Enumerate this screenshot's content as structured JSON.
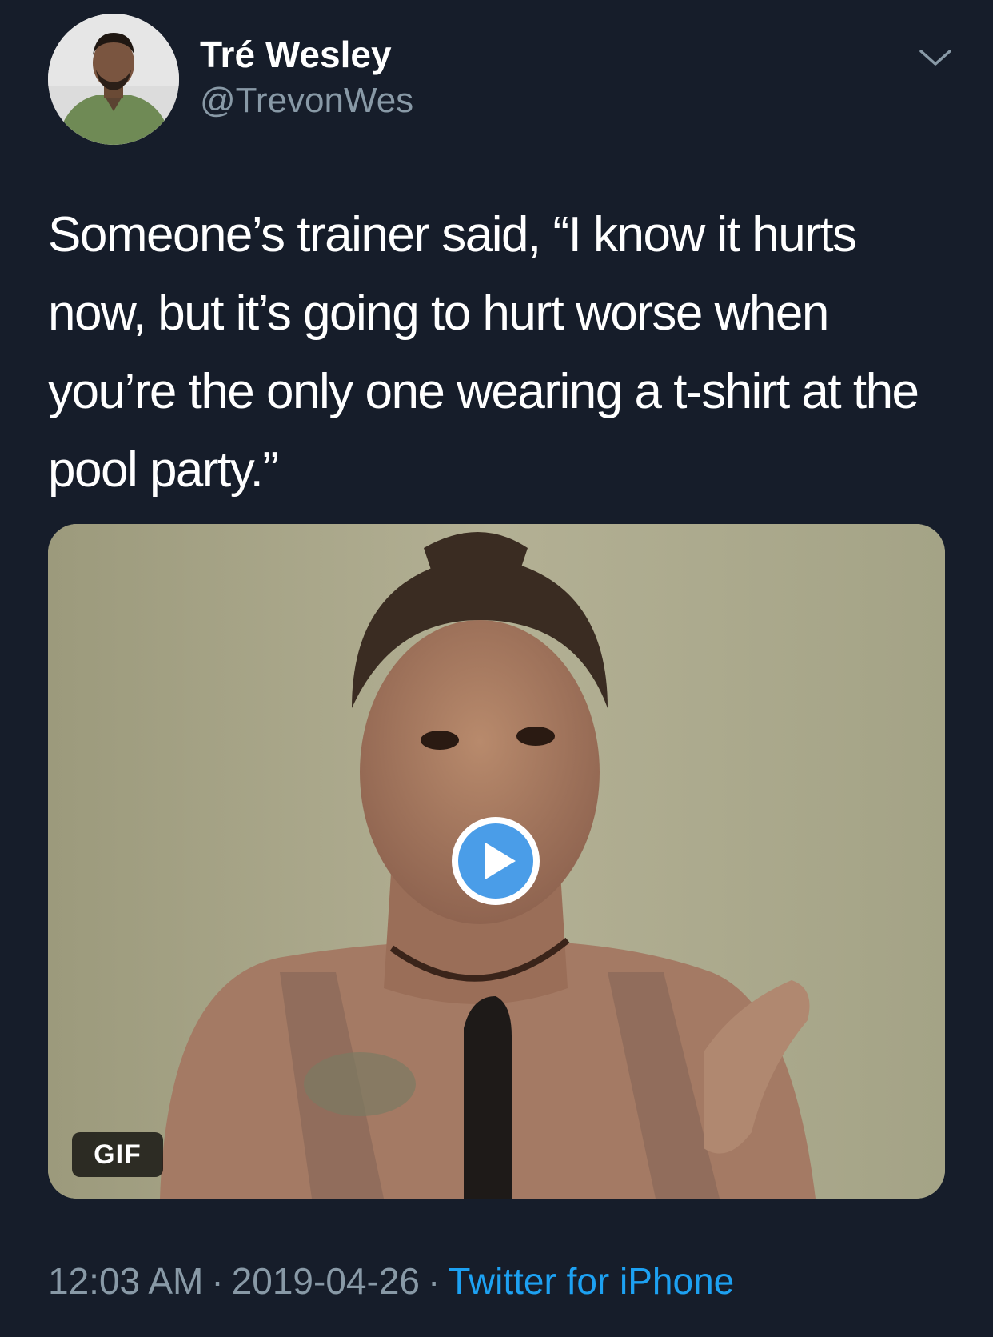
{
  "author": {
    "display_name": "Tré Wesley",
    "handle": "@TrevonWes",
    "avatar_icon": "user-avatar"
  },
  "header": {
    "menu_icon": "chevron-down-icon"
  },
  "tweet": {
    "text": "Someone’s trainer said, “I know it hurts now, but it’s going to hurt worse when you’re the only one wearing a t-shirt at the pool party.”"
  },
  "media": {
    "type": "gif",
    "badge_label": "GIF",
    "play_icon": "play-icon"
  },
  "footer": {
    "time": "12:03 AM",
    "separator": "·",
    "date": "2019-04-26",
    "source": "Twitter for iPhone"
  },
  "colors": {
    "background": "#161d2a",
    "primary_text": "#ffffff",
    "secondary_text": "#8899a6",
    "link": "#1da1f2",
    "play_button": "#4a9de8"
  }
}
